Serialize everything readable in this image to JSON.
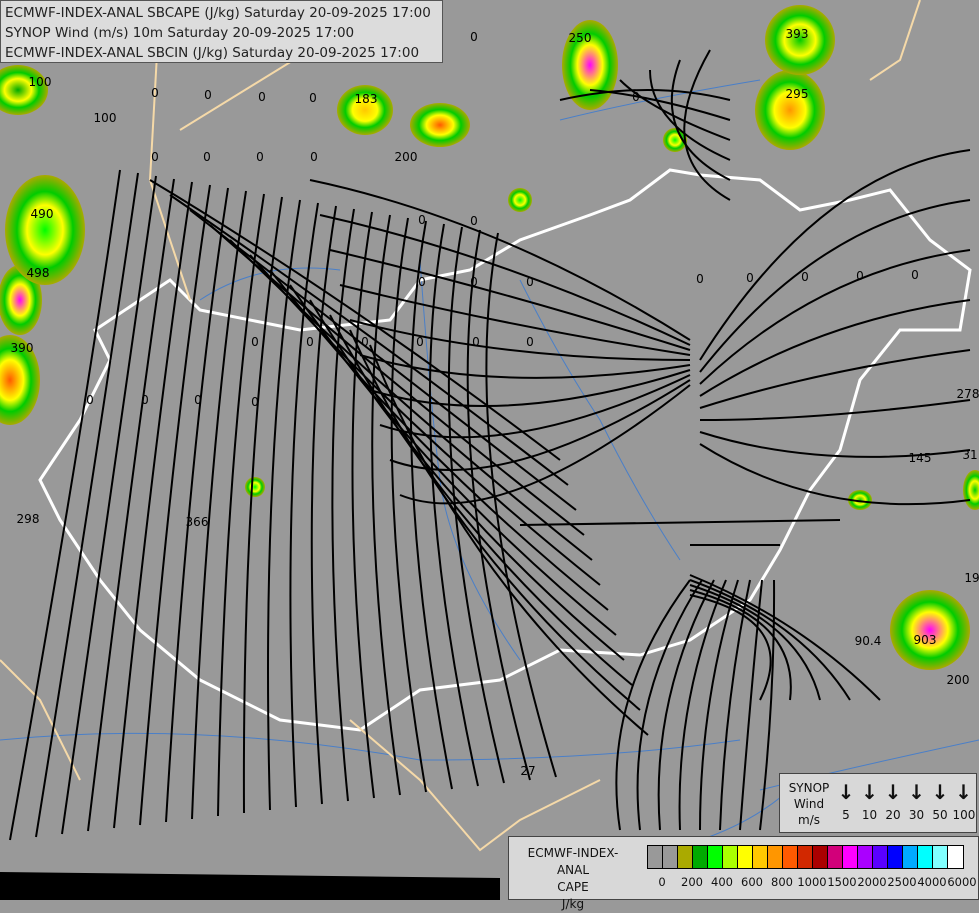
{
  "header": {
    "lines": [
      "ECMWF-INDEX-ANAL SBCAPE (J/kg) Saturday 20-09-2025 17:00",
      "SYNOP Wind (m/s) 10m Saturday 20-09-2025 17:00",
      "ECMWF-INDEX-ANAL SBCIN (J/kg) Saturday 20-09-2025 17:00"
    ]
  },
  "wind_legend": {
    "label_lines": [
      "SYNOP",
      "Wind",
      "m/s"
    ],
    "icon": "wind-arrow-down-icon",
    "speeds": [
      "5",
      "10",
      "20",
      "30",
      "50",
      "100"
    ]
  },
  "cape_legend": {
    "title_lines": [
      "ECMWF-INDEX-ANAL",
      "CAPE",
      "J/kg"
    ],
    "colors": [
      "#999999",
      "#999999",
      "#aaaa00",
      "#00aa00",
      "#00ff00",
      "#aaff00",
      "#ffff00",
      "#ffc800",
      "#ff9600",
      "#ff5a00",
      "#d22800",
      "#aa0000",
      "#d2007a",
      "#ff00ff",
      "#aa00ff",
      "#5a00ff",
      "#0000ff",
      "#00aaff",
      "#00ffff",
      "#80ffff",
      "#ffffff"
    ],
    "ticks": [
      "0",
      "200",
      "400",
      "600",
      "800",
      "1000",
      "1500",
      "2000",
      "2500",
      "4000",
      "6000"
    ]
  },
  "map_values": [
    "393",
    "295",
    "250",
    "183",
    "200",
    "490",
    "498",
    "390",
    "366",
    "298",
    "145",
    "278",
    "31",
    "19",
    "90.4",
    "903",
    "200",
    "27",
    "100",
    "100",
    "0",
    "0",
    "0",
    "0",
    "0",
    "0",
    "0",
    "0",
    "0",
    "0",
    "0",
    "0",
    "0",
    "0",
    "0",
    "0",
    "0",
    "0",
    "0",
    "0",
    "0",
    "0",
    "0",
    "0",
    "0",
    "0",
    "0",
    "0",
    "0",
    "0"
  ],
  "colors": {
    "background": "#999999",
    "border": "#ffffff",
    "river": "#4a7fc8",
    "neighbour_border": "#f5d9a8",
    "streamline": "#000000"
  }
}
